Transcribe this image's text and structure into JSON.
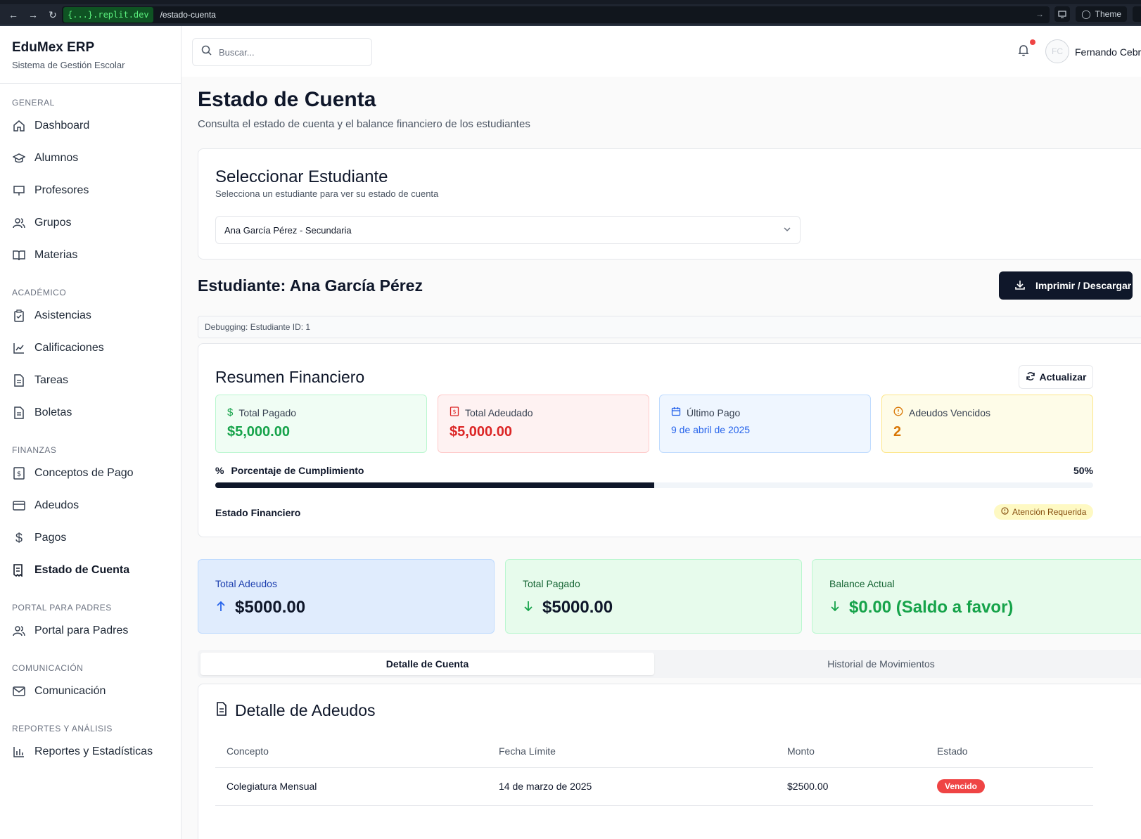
{
  "browser": {
    "host": "{...}.replit.dev",
    "path": "/estado-cuenta",
    "theme_label": "Theme"
  },
  "sidebar": {
    "app_name": "EduMex ERP",
    "app_subtitle": "Sistema de Gestión Escolar",
    "sections": {
      "general": "GENERAL",
      "academico": "ACADÉMICO",
      "finanzas": "FINANZAS",
      "portal": "PORTAL PARA PADRES",
      "comunicacion": "COMUNICACIÓN",
      "reportes": "REPORTES Y ANÁLISIS"
    },
    "items": {
      "dashboard": "Dashboard",
      "alumnos": "Alumnos",
      "profesores": "Profesores",
      "grupos": "Grupos",
      "materias": "Materias",
      "asistencias": "Asistencias",
      "calificaciones": "Calificaciones",
      "tareas": "Tareas",
      "boletas": "Boletas",
      "conceptos": "Conceptos de Pago",
      "adeudos": "Adeudos",
      "pagos": "Pagos",
      "estado_cuenta": "Estado de Cuenta",
      "portal_padres": "Portal para Padres",
      "comunicacion": "Comunicación",
      "reportes": "Reportes y Estadísticas"
    }
  },
  "header": {
    "search_placeholder": "Buscar...",
    "avatar_initials": "FC",
    "user_name": "Fernando Cebre"
  },
  "page": {
    "title": "Estado de Cuenta",
    "subtitle": "Consulta el estado de cuenta y el balance financiero de los estudiantes"
  },
  "select_card": {
    "title": "Seleccionar Estudiante",
    "subtitle": "Selecciona un estudiante para ver su estado de cuenta",
    "selected": "Ana García Pérez - Secundaria"
  },
  "student": {
    "heading": "Estudiante: Ana García Pérez",
    "print_label": "Imprimir / Descargar",
    "debug": "Debugging: Estudiante ID: 1"
  },
  "summary": {
    "title": "Resumen Financiero",
    "refresh_label": "Actualizar",
    "total_pagado_label": "Total Pagado",
    "total_pagado": "$5,000.00",
    "total_adeudado_label": "Total Adeudado",
    "total_adeudado": "$5,000.00",
    "ultimo_pago_label": "Último Pago",
    "ultimo_pago": "9 de abril de 2025",
    "vencidos_label": "Adeudos Vencidos",
    "vencidos": "2",
    "pct_label": "Porcentaje de Cumplimiento",
    "pct_text": "50%",
    "pct_value": 0.5,
    "estado_label": "Estado Financiero",
    "estado_badge": "Atención Requerida"
  },
  "totals": {
    "adeudos_label": "Total Adeudos",
    "adeudos": "$5000.00",
    "pagado_label": "Total Pagado",
    "pagado": "$5000.00",
    "balance_label": "Balance Actual",
    "balance": "$0.00 (Saldo a favor)"
  },
  "tabs": {
    "detalle": "Detalle de Cuenta",
    "historial": "Historial de Movimientos"
  },
  "detail": {
    "title": "Detalle de Adeudos",
    "columns": [
      "Concepto",
      "Fecha Límite",
      "Monto",
      "Estado"
    ],
    "rows": [
      {
        "concepto": "Colegiatura Mensual",
        "fecha": "14 de marzo de 2025",
        "monto": "$2500.00",
        "estado": "Vencido"
      }
    ]
  },
  "colors": {
    "primary": "#0f172a",
    "success": "#16a34a",
    "danger": "#dc2626",
    "info": "#2563eb",
    "warning": "#d97706"
  }
}
